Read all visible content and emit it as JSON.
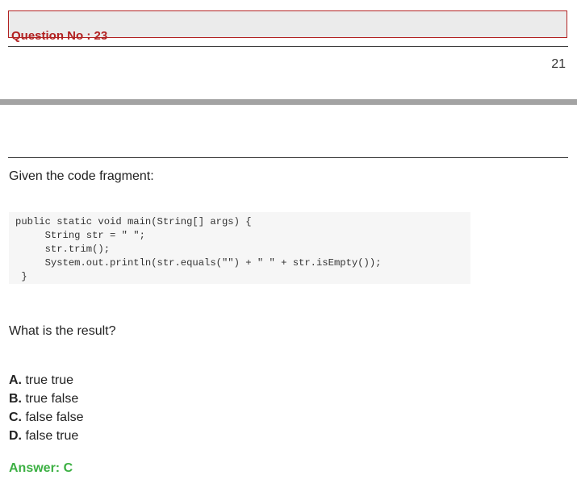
{
  "header": {
    "question_label": "Question No : 23",
    "page_number": "21"
  },
  "intro": "Given the code fragment:",
  "code_lines": [
    "public static void main(String[] args) {",
    "     String str = \" \";",
    "     str.trim();",
    "     System.out.println(str.equals(\"\") + \" \" + str.isEmpty());",
    " }"
  ],
  "question": "What is the result?",
  "options": [
    {
      "letter": "A.",
      "text": " true true"
    },
    {
      "letter": "B.",
      "text": " true false"
    },
    {
      "letter": "C.",
      "text": " false false"
    },
    {
      "letter": "D.",
      "text": " false true"
    }
  ],
  "answer": "Answer: C"
}
